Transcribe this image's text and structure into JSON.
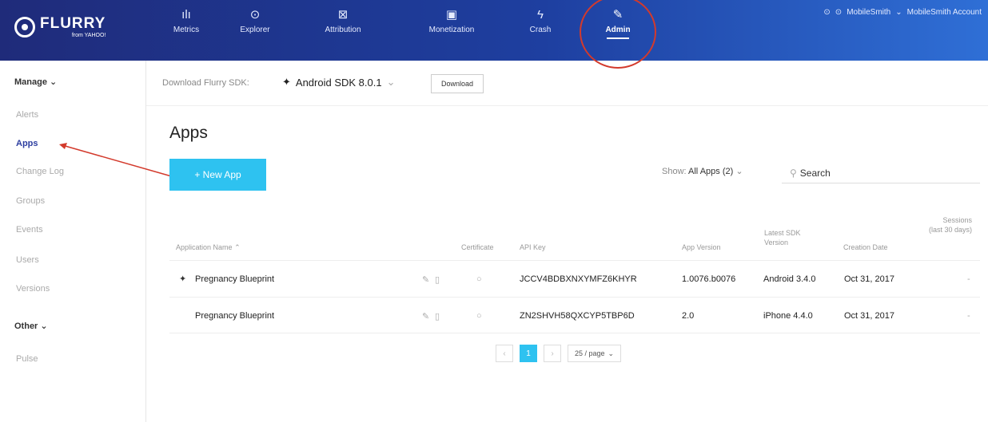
{
  "brand": {
    "name": "FLURRY",
    "sub": "from YAHOO!"
  },
  "nav": [
    {
      "label": "Metrics",
      "icon": "bar-chart-icon",
      "glyph": "ılı"
    },
    {
      "label": "Explorer",
      "icon": "compass-icon",
      "glyph": "⊙"
    },
    {
      "label": "Attribution",
      "icon": "attribution-icon",
      "glyph": "⊠"
    },
    {
      "label": "Monetization",
      "icon": "monetization-icon",
      "glyph": "▣"
    },
    {
      "label": "Crash",
      "icon": "crash-icon",
      "glyph": "ϟ"
    },
    {
      "label": "Admin",
      "icon": "wrench-icon",
      "glyph": "✎"
    }
  ],
  "account": {
    "user": "MobileSmith",
    "account": "MobileSmith Account"
  },
  "sidebar": {
    "manage": "Manage",
    "items": [
      "Alerts",
      "Apps",
      "Change Log",
      "Groups",
      "Events",
      "Users",
      "Versions"
    ],
    "other": "Other",
    "other_items": [
      "Pulse"
    ]
  },
  "sdk": {
    "label": "Download Flurry SDK:",
    "selected": "Android SDK 8.0.1",
    "button": "Download"
  },
  "page": {
    "title": "Apps",
    "new_app": "+ New App"
  },
  "filter": {
    "show_label": "Show:",
    "show_value": "All Apps (2)",
    "search_placeholder": "Search"
  },
  "table": {
    "headers": {
      "name": "Application Name",
      "certificate": "Certificate",
      "api_key": "API Key",
      "app_version": "App Version",
      "latest_sdk": "Latest SDK Version",
      "creation": "Creation Date",
      "sessions": "Sessions (last 30 days)"
    },
    "rows": [
      {
        "platform": "android",
        "name": "Pregnancy Blueprint",
        "api_key": "JCCV4BDBXNXYMFZ6KHYR",
        "app_version": "1.0076.b0076",
        "sdk": "Android 3.4.0",
        "created": "Oct 31, 2017",
        "sessions": "-"
      },
      {
        "platform": "ios",
        "name": "Pregnancy Blueprint",
        "api_key": "ZN2SHVH58QXCYP5TBP6D",
        "app_version": "2.0",
        "sdk": "iPhone 4.4.0",
        "created": "Oct 31, 2017",
        "sessions": "-"
      }
    ]
  },
  "pager": {
    "prev": "‹",
    "page": "1",
    "next": "›",
    "per_page": "25 / page"
  },
  "colors": {
    "accent": "#2ec2f0",
    "nav_start": "#1f2b7a",
    "nav_end": "#2f6fd6",
    "annotation": "#d33a2c"
  }
}
